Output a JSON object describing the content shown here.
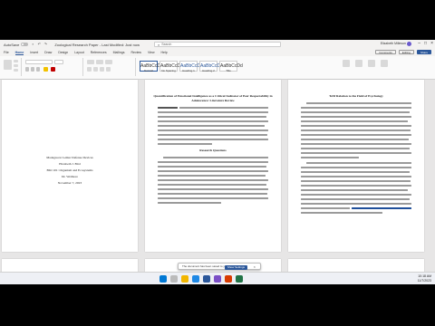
{
  "titlebar": {
    "autosave_label": "AutoSave",
    "doc_title": "Zoological Research Paper - Last Modified: Just now",
    "search_placeholder": "Search",
    "user_name": "Elizabeth Milleson"
  },
  "tabs": [
    "File",
    "Home",
    "Insert",
    "Draw",
    "Design",
    "Layout",
    "References",
    "Mailings",
    "Review",
    "View",
    "Help"
  ],
  "active_tab": "Home",
  "ribbon_right": {
    "comments": "Comments",
    "editing": "Editing",
    "share": "Share"
  },
  "styles": [
    "Normal",
    "No Spacing",
    "Heading 1",
    "Heading 2",
    "Title"
  ],
  "style_sample": "AaBbCcDd",
  "cover_page": {
    "lines": [
      "Madagascar Lemur Defense Devices",
      "Elizabeth J. Bird",
      "BIO 101: Organism and Ecosystems",
      "Dr. Wetmore",
      "November 7, 2023"
    ]
  },
  "page2": {
    "title_line1": "Quantification of Emotional Intelligence as a Critical Indicator of Peer Respectability in",
    "title_line2": "Adolescence: Literature Review",
    "section_heading": "Research Questions"
  },
  "page3": {
    "section_heading": "ToM Relation to the Field of Psychology"
  },
  "toast": {
    "message": "The document has been saved to your device",
    "button": "Show Settings"
  },
  "tray": {
    "time": "10:18 AM",
    "date": "11/7/2023"
  },
  "colors": {
    "accent": "#2b579a",
    "ribbon_bg": "#fafafa",
    "canvas_bg": "#e7e6e6"
  }
}
